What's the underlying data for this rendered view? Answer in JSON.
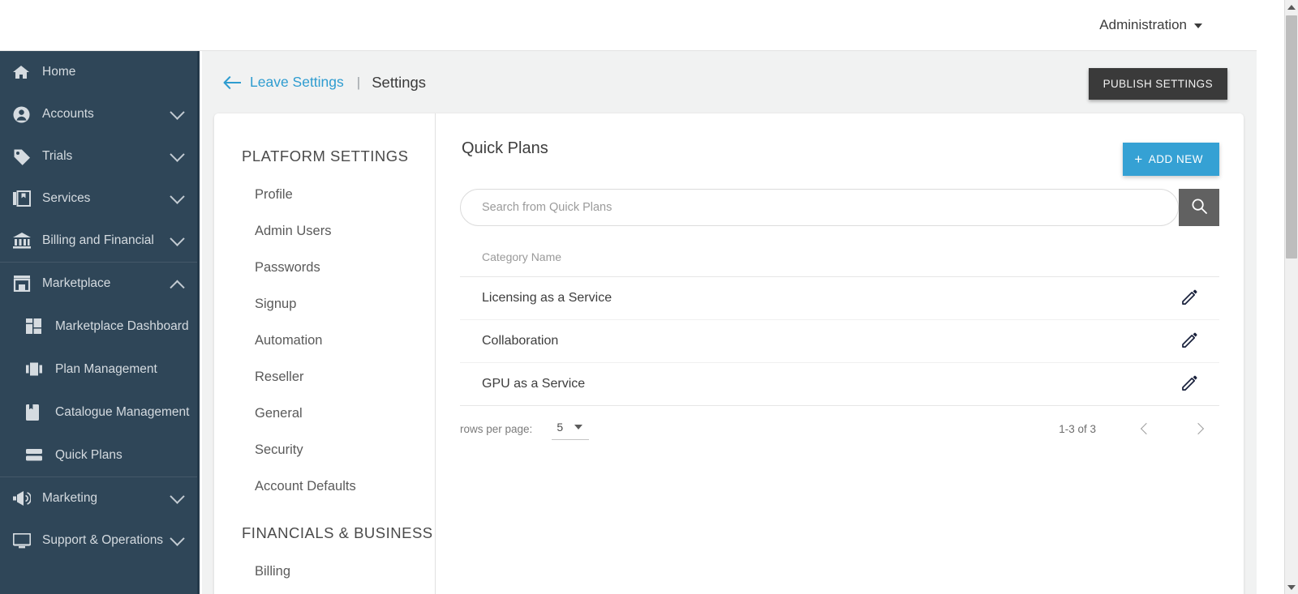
{
  "topbar": {
    "account_menu_label": "Administration",
    "caret_icon": "chevron-down-icon"
  },
  "sidebar": {
    "background_color": "#2f4658",
    "items": [
      {
        "label": "Home",
        "icon": "home-icon",
        "expandable": false,
        "expanded": false,
        "level": 0
      },
      {
        "label": "Accounts",
        "icon": "user-circle-icon",
        "expandable": true,
        "expanded": false,
        "level": 0
      },
      {
        "label": "Trials",
        "icon": "tag-icon",
        "expandable": true,
        "expanded": false,
        "level": 0
      },
      {
        "label": "Services",
        "icon": "services-stack-icon",
        "expandable": true,
        "expanded": false,
        "level": 0
      },
      {
        "label": "Billing and Financial",
        "icon": "bank-icon",
        "expandable": true,
        "expanded": false,
        "level": 0
      },
      {
        "label": "Marketplace",
        "icon": "store-icon",
        "expandable": true,
        "expanded": true,
        "level": 0
      },
      {
        "label": "Marketplace Dashboard",
        "icon": "dashboard-grid-icon",
        "expandable": false,
        "expanded": false,
        "level": 1
      },
      {
        "label": "Plan Management",
        "icon": "plan-cards-icon",
        "expandable": false,
        "expanded": false,
        "level": 1
      },
      {
        "label": "Catalogue Management",
        "icon": "book-bookmark-icon",
        "expandable": false,
        "expanded": false,
        "level": 1
      },
      {
        "label": "Quick Plans",
        "icon": "stacked-bars-icon",
        "expandable": false,
        "expanded": false,
        "level": 1
      },
      {
        "label": "Marketing",
        "icon": "megaphone-icon",
        "expandable": true,
        "expanded": false,
        "level": 0
      },
      {
        "label": "Support & Operations",
        "icon": "monitor-icon",
        "expandable": true,
        "expanded": false,
        "level": 0
      }
    ]
  },
  "breadcrumb": {
    "back_icon": "arrow-left-icon",
    "back_link": "Leave Settings",
    "divider": "|",
    "current": "Settings"
  },
  "actions": {
    "publish_label": "PUBLISH SETTINGS",
    "publish_color": "#3a3a3a"
  },
  "settings_nav": {
    "sections": [
      {
        "title": "PLATFORM SETTINGS",
        "items": [
          "Profile",
          "Admin Users",
          "Passwords",
          "Signup",
          "Automation",
          "Reseller",
          "General",
          "Security",
          "Account Defaults"
        ]
      },
      {
        "title": "FINANCIALS & BUSINESS",
        "items": [
          "Billing"
        ]
      }
    ]
  },
  "panel": {
    "title": "Quick Plans",
    "add_new_label": "ADD NEW",
    "add_new_plus": "+",
    "add_new_color": "#35a1d4",
    "search": {
      "placeholder": "Search from Quick Plans",
      "value": "",
      "button_icon": "search-icon"
    },
    "table": {
      "columns": [
        "Category Name"
      ],
      "rows": [
        {
          "category_name": "Licensing as a Service",
          "edit_icon": "pencil-icon"
        },
        {
          "category_name": "Collaboration",
          "edit_icon": "pencil-icon"
        },
        {
          "category_name": "GPU as a Service",
          "edit_icon": "pencil-icon"
        }
      ]
    },
    "pagination": {
      "rows_per_page_label": "rows per page:",
      "rows_per_page_value": "5",
      "range": "1-3 of 3",
      "prev_icon": "chevron-left-icon",
      "next_icon": "chevron-right-icon"
    }
  }
}
